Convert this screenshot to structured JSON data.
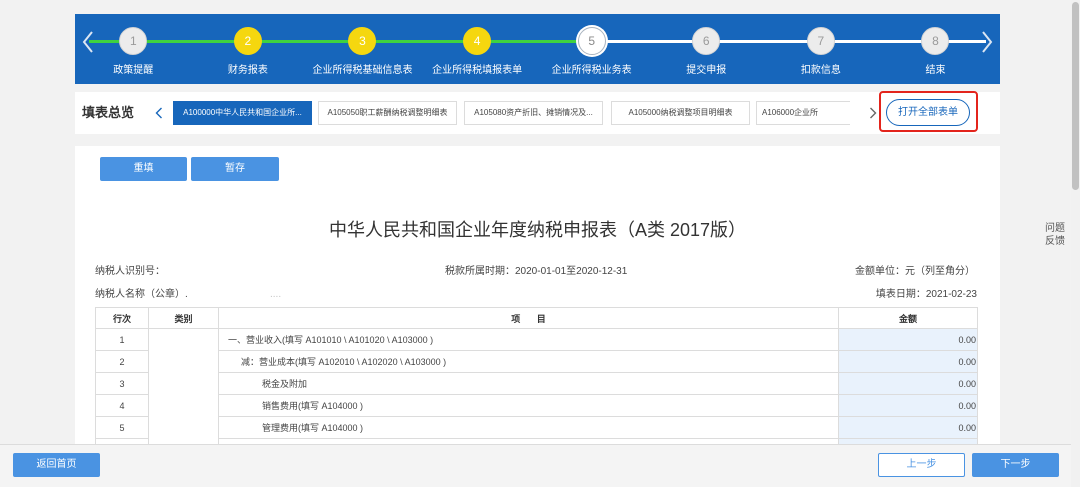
{
  "colors": {
    "banner": "#1766bb",
    "progress_done": "#3fd23f",
    "progress_todo": "#ffffff",
    "step_completed": "#f5d70f",
    "step_pending": "#ececec",
    "button": "#4a93e2",
    "highlight_box": "#e3241c",
    "amount_cell": "#e9f2fc"
  },
  "icons": {
    "banner_prev": "chevron-left-icon",
    "banner_next": "chevron-right-icon",
    "tabs_prev": "chevron-left-icon",
    "tabs_next": "chevron-right-icon"
  },
  "steps": {
    "current_step": 5,
    "items": [
      {
        "number": "1",
        "label": "政策提醒",
        "completed": false
      },
      {
        "number": "2",
        "label": "财务报表",
        "completed": true
      },
      {
        "number": "3",
        "label": "企业所得税基础信息表",
        "completed": true
      },
      {
        "number": "4",
        "label": "企业所得税填报表单",
        "completed": true
      },
      {
        "number": "5",
        "label": "企业所得税业务表",
        "completed": false
      },
      {
        "number": "6",
        "label": "提交申报",
        "completed": false
      },
      {
        "number": "7",
        "label": "扣款信息",
        "completed": false
      },
      {
        "number": "8",
        "label": "结束",
        "completed": false
      }
    ]
  },
  "form_nav": {
    "title": "填表总览",
    "tabs": [
      {
        "label": "A100000中华人民共和国企业所...",
        "active": true
      },
      {
        "label": "A105050职工薪酬纳税调整明细表",
        "active": false
      },
      {
        "label": "A105080资产折旧、摊销情况及...",
        "active": false
      },
      {
        "label": "A105000纳税调整项目明细表",
        "active": false
      },
      {
        "label": "A106000企业所",
        "active": false
      }
    ],
    "open_all_label": "打开全部表单"
  },
  "toolbar": {
    "reset_label": "重填",
    "save_draft_label": "暂存"
  },
  "form": {
    "title": "中华人民共和国企业年度纳税申报表（A类 2017版）",
    "taxpayer_id_label": "纳税人识别号：",
    "tax_period": "税款所属时期：2020-01-01至2020-12-31",
    "amount_unit": "金额单位：元（列至角分）",
    "taxpayer_name_label": "纳税人名称（公章）.",
    "taxpayer_name_value": "....",
    "fill_date": "填表日期：2021-02-23",
    "columns": [
      "行次",
      "类别",
      "项 目",
      "金额"
    ],
    "rows": [
      {
        "no": "1",
        "item": "一、营业收入(填写 A101010 \\ A101020 \\ A103000 )",
        "amount": "0.00"
      },
      {
        "no": "2",
        "item": "减：营业成本(填写 A102010 \\ A102020 \\ A103000 )",
        "amount": "0.00"
      },
      {
        "no": "3",
        "item": "税金及附加",
        "amount": "0.00"
      },
      {
        "no": "4",
        "item": "销售费用(填写 A104000 )",
        "amount": "0.00"
      },
      {
        "no": "5",
        "item": "管理费用(填写 A104000 )",
        "amount": "0.00"
      }
    ]
  },
  "footer": {
    "home_label": "返回首页",
    "prev_label": "上一步",
    "next_label": "下一步"
  },
  "feedback": {
    "line1": "问题",
    "line2": "反馈"
  }
}
